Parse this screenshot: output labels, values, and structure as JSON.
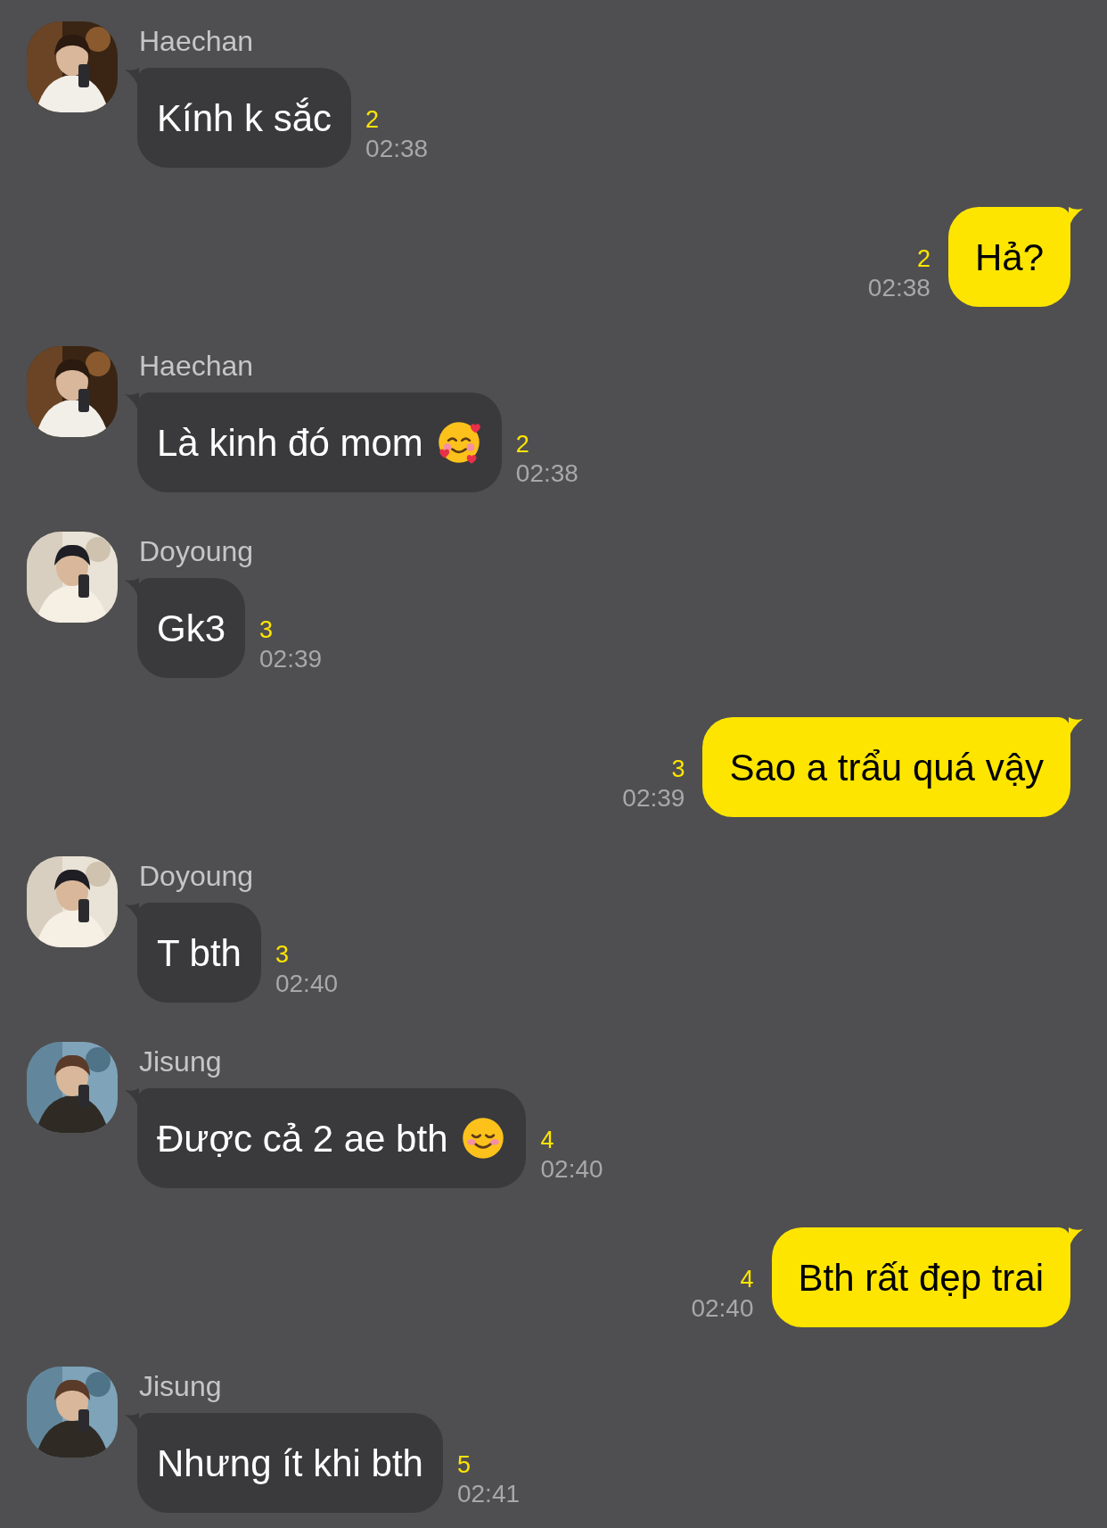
{
  "messages": [
    {
      "kind": "incoming",
      "sender": "Haechan",
      "text": "Kính k sắc",
      "unread": "2",
      "time": "02:38"
    },
    {
      "kind": "outgoing",
      "text": "Hả?",
      "unread": "2",
      "time": "02:38"
    },
    {
      "kind": "incoming",
      "sender": "Haechan",
      "text": "Là kinh đó mom",
      "emoji": {
        "kind": "hearts"
      },
      "unread": "2",
      "time": "02:38"
    },
    {
      "kind": "incoming",
      "sender": "Doyoung",
      "text": "Gk3",
      "unread": "3",
      "time": "02:39"
    },
    {
      "kind": "outgoing",
      "text": "Sao a trẩu quá vậy",
      "unread": "3",
      "time": "02:39"
    },
    {
      "kind": "incoming",
      "sender": "Doyoung",
      "text": "T bth",
      "unread": "3",
      "time": "02:40"
    },
    {
      "kind": "incoming",
      "sender": "Jisung",
      "text": "Được cả 2 ae bth",
      "emoji": {
        "kind": "blush"
      },
      "unread": "4",
      "time": "02:40"
    },
    {
      "kind": "outgoing",
      "text": "Bth rất đẹp trai",
      "unread": "4",
      "time": "02:40"
    },
    {
      "kind": "incoming",
      "sender": "Jisung",
      "text": "Nhưng ít khi bth",
      "unread": "5",
      "time": "02:41"
    }
  ]
}
